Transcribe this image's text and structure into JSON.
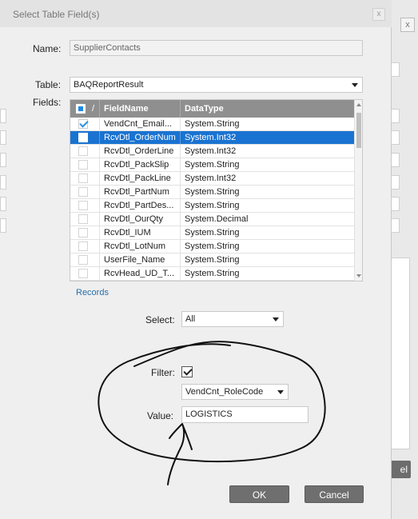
{
  "dialog": {
    "title": "Select Table Field(s)",
    "close_glyph": "x"
  },
  "name": {
    "label": "Name:",
    "value": "SupplierContacts"
  },
  "table": {
    "label": "Table:",
    "value": "BAQReportResult"
  },
  "fields": {
    "label": "Fields:",
    "columns": [
      "FieldName",
      "DataType"
    ],
    "header_slash": "/",
    "rows": [
      {
        "name": "VendCnt_Email...",
        "type": "System.String",
        "checked": true,
        "selected": false
      },
      {
        "name": "RcvDtl_OrderNum",
        "type": "System.Int32",
        "checked": false,
        "selected": true
      },
      {
        "name": "RcvDtl_OrderLine",
        "type": "System.Int32",
        "checked": false,
        "selected": false
      },
      {
        "name": "RcvDtl_PackSlip",
        "type": "System.String",
        "checked": false,
        "selected": false
      },
      {
        "name": "RcvDtl_PackLine",
        "type": "System.Int32",
        "checked": false,
        "selected": false
      },
      {
        "name": "RcvDtl_PartNum",
        "type": "System.String",
        "checked": false,
        "selected": false
      },
      {
        "name": "RcvDtl_PartDes...",
        "type": "System.String",
        "checked": false,
        "selected": false
      },
      {
        "name": "RcvDtl_OurQty",
        "type": "System.Decimal",
        "checked": false,
        "selected": false
      },
      {
        "name": "RcvDtl_IUM",
        "type": "System.String",
        "checked": false,
        "selected": false
      },
      {
        "name": "RcvDtl_LotNum",
        "type": "System.String",
        "checked": false,
        "selected": false
      },
      {
        "name": "UserFile_Name",
        "type": "System.String",
        "checked": false,
        "selected": false
      },
      {
        "name": "RcvHead_UD_T...",
        "type": "System.String",
        "checked": false,
        "selected": false
      }
    ]
  },
  "records_link": "Records",
  "select": {
    "label": "Select:",
    "value": "All"
  },
  "filter": {
    "label": "Filter:",
    "checked": true,
    "field_value": "VendCnt_RoleCode"
  },
  "value": {
    "label": "Value:",
    "value": "LOGISTICS"
  },
  "buttons": {
    "ok": "OK",
    "cancel": "Cancel"
  },
  "background": {
    "cancel_fragment": "el"
  },
  "colors": {
    "selection": "#1a73d1",
    "header": "#8f8f8f",
    "button": "#6f6f6f",
    "link": "#2a6fa8"
  }
}
